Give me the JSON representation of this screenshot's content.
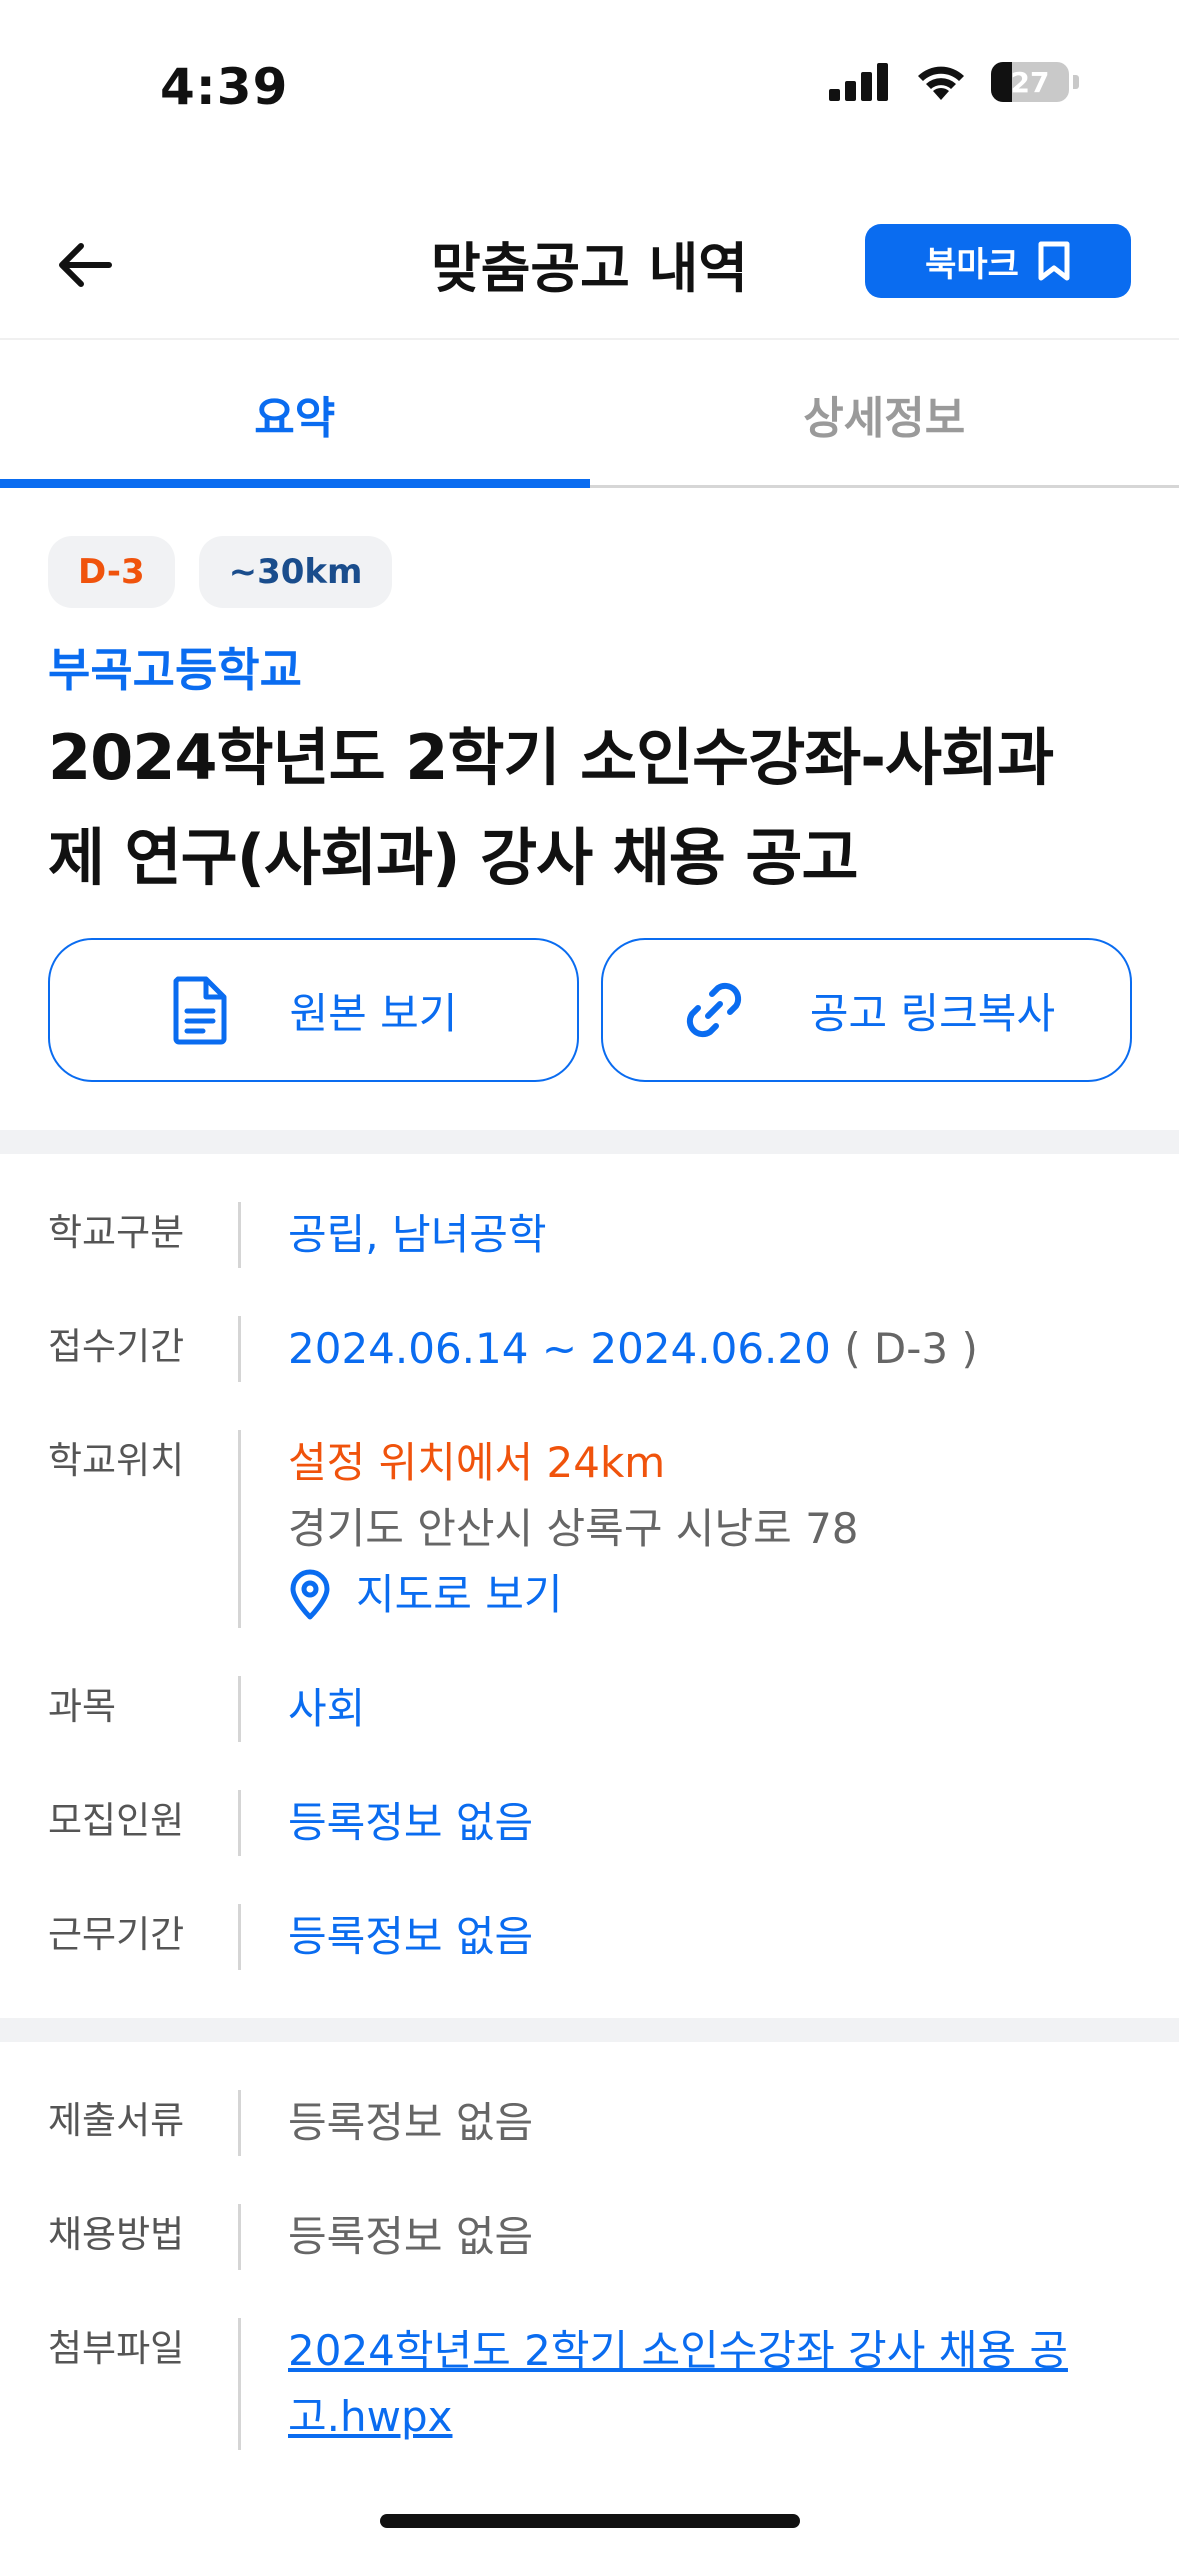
{
  "status": {
    "time": "4:39",
    "battery": "27",
    "battery_level": 0.27
  },
  "header": {
    "title": "맞춤공고 내역",
    "bookmark_label": "북마크"
  },
  "tabs": [
    {
      "label": "요약",
      "active": true
    },
    {
      "label": "상세정보",
      "active": false
    }
  ],
  "summary": {
    "badges": {
      "dday": "D-3",
      "distance": "~30km"
    },
    "school": "부곡고등학교",
    "title_line1": "2024학년도 2학기 소인수강좌-사회과",
    "title_line2": "제 연구(사회과) 강사 채용 공고"
  },
  "actions": {
    "view_original": "원본 보기",
    "copy_link": "공고 링크복사"
  },
  "info": {
    "school_type": {
      "label": "학교구분",
      "value": "공립, 남녀공학"
    },
    "period": {
      "label": "접수기간",
      "value": "2024.06.14 ~ 2024.06.20",
      "suffix": " ( D-3 )"
    },
    "location": {
      "label": "학교위치",
      "distance": "설정 위치에서 24km",
      "address": "경기도 안산시 상록구 시낭로 78",
      "map_label": "지도로 보기"
    },
    "subject": {
      "label": "과목",
      "value": "사회"
    },
    "recruits": {
      "label": "모집인원",
      "value": "등록정보 없음"
    },
    "work_period": {
      "label": "근무기간",
      "value": "등록정보 없음"
    }
  },
  "info2": {
    "documents": {
      "label": "제출서류",
      "value": "등록정보 없음"
    },
    "method": {
      "label": "채용방법",
      "value": "등록정보 없음"
    },
    "attachment": {
      "label": "첨부파일",
      "line1": "2024학년도 2학기 소인수강좌 강사 채용 공",
      "line2": "고.hwpx"
    }
  },
  "colors": {
    "accent": "#0a6cf0",
    "warning": "#f0530c"
  }
}
